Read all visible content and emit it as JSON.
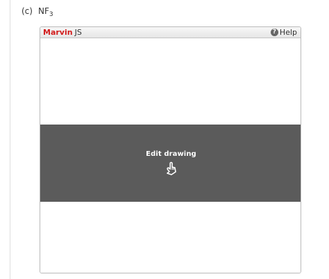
{
  "question": {
    "part_label": "(c)",
    "formula_main": "NF",
    "formula_sub": "3"
  },
  "editor": {
    "brand_name": "Marvin",
    "brand_suffix": "JS",
    "help_label": "Help",
    "help_icon": "question-circle-icon",
    "overlay_label": "Edit drawing",
    "overlay_icon": "pointing-hand-icon",
    "colors": {
      "brand_red": "#d21d1d",
      "overlay_bg": "#5b5b5b"
    }
  }
}
